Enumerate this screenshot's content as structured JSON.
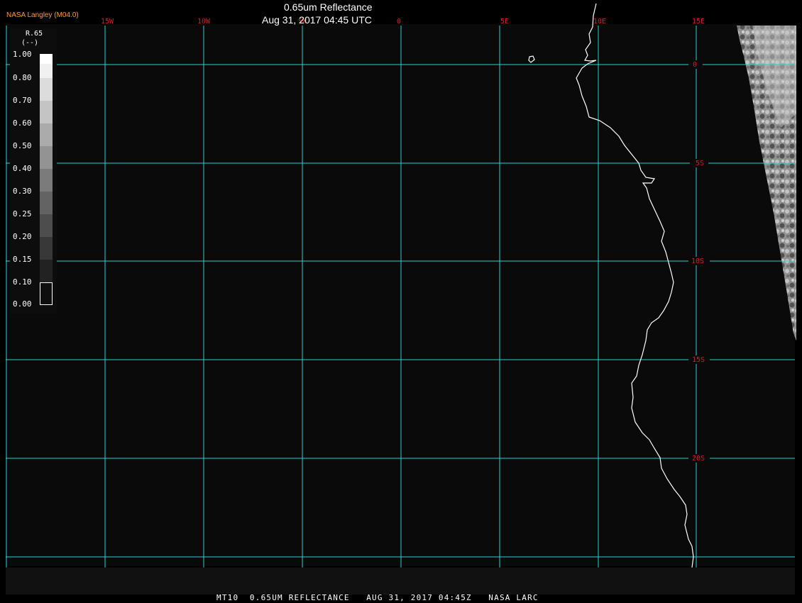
{
  "header": {
    "title": "0.65um Reflectance",
    "subtitle": "Aug 31, 2017 04:45 UTC",
    "brand": "NASA Langley (M04.0)"
  },
  "footer": {
    "caption": "MT10  0.65UM REFLECTANCE   AUG 31, 2017 04:45Z   NASA LARC"
  },
  "colorbar": {
    "variable": "R.65",
    "unit": "(--)",
    "ticks": [
      "1.00",
      "0.80",
      "0.70",
      "0.60",
      "0.50",
      "0.40",
      "0.30",
      "0.25",
      "0.20",
      "0.15",
      "0.10",
      "0.00"
    ]
  },
  "map": {
    "longitude_labels": [
      "15W",
      "10W",
      "5W",
      "0",
      "5E",
      "10E",
      "15E"
    ],
    "latitude_labels": [
      "0",
      "5S",
      "10S",
      "15S",
      "20S"
    ],
    "colors": {
      "background": "#0a0a0a",
      "grid": "#33cccc",
      "grid_label": "#cc2222",
      "coastline": "#ffffff",
      "brand_text": "#ff9933"
    }
  }
}
